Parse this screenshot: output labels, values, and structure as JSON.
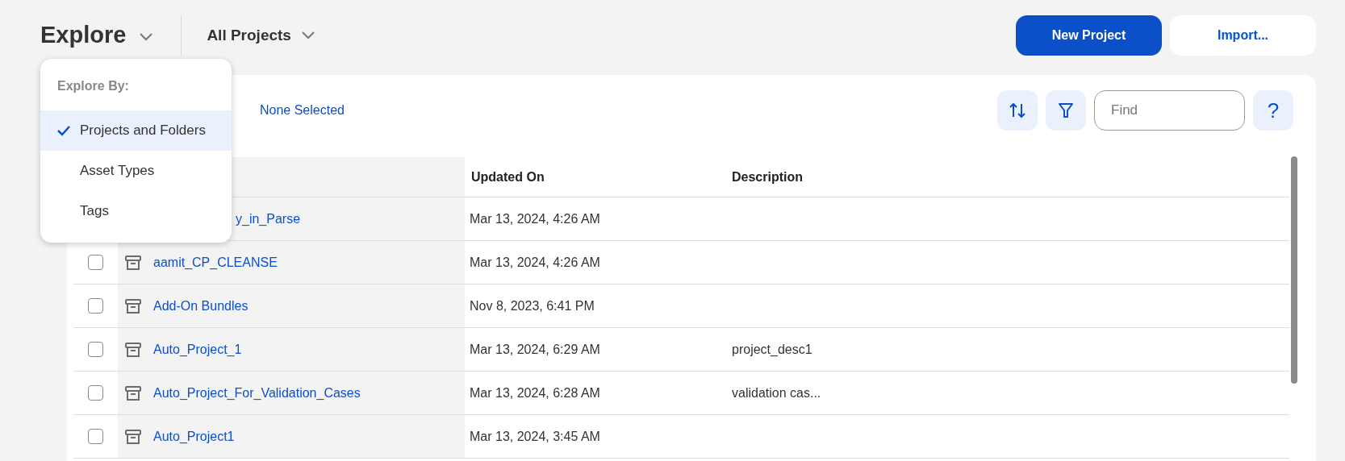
{
  "header": {
    "title": "Explore",
    "scope": "All Projects",
    "buttons": [
      {
        "label": "New Project",
        "kind": "primary"
      },
      {
        "label": "Import...",
        "kind": "secondary"
      }
    ]
  },
  "menu": {
    "heading": "Explore By:",
    "items": [
      {
        "label": "Projects and Folders",
        "selected": true
      },
      {
        "label": "Asset Types",
        "selected": false
      },
      {
        "label": "Tags",
        "selected": false
      }
    ]
  },
  "toolbar": {
    "selection": "None Selected",
    "find_placeholder": "Find",
    "help": "?"
  },
  "table": {
    "columns": [
      "Updated On",
      "Description"
    ],
    "rows": [
      {
        "name": "y_in_Parse",
        "clipped": true,
        "updated": "Mar 13, 2024, 4:26 AM",
        "description": ""
      },
      {
        "name": "aamit_CP_CLEANSE",
        "clipped": false,
        "updated": "Mar 13, 2024, 4:26 AM",
        "description": "",
        "checked": false
      },
      {
        "name": "Add-On Bundles",
        "clipped": false,
        "updated": "Nov 8, 2023, 6:41 PM",
        "description": "",
        "checked": false
      },
      {
        "name": "Auto_Project_1",
        "clipped": false,
        "updated": "Mar 13, 2024, 6:29 AM",
        "description": "project_desc1",
        "checked": false
      },
      {
        "name": "Auto_Project_For_Validation_Cases",
        "clipped": false,
        "updated": "Mar 13, 2024, 6:28 AM",
        "description": "validation cas...",
        "checked": false
      },
      {
        "name": "Auto_Project1",
        "clipped": false,
        "updated": "Mar 13, 2024, 3:45 AM",
        "description": "",
        "checked": false
      }
    ]
  }
}
